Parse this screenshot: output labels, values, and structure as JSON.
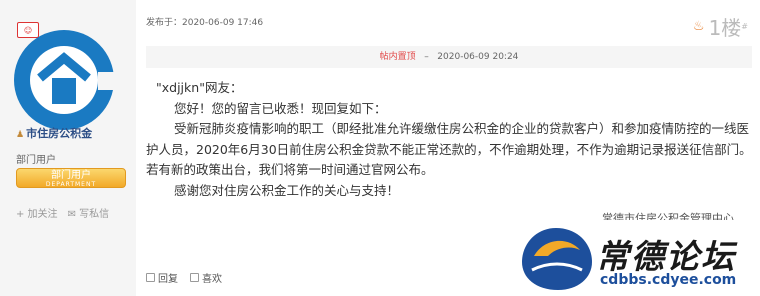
{
  "sidebar": {
    "author": "市住房公积金",
    "group": "部门用户",
    "badge": {
      "main": "部门用户",
      "sub": "DEPARTMENT"
    },
    "actions": {
      "follow": "+ 加关注",
      "message": "写私信"
    }
  },
  "post": {
    "posted_at": "发布于：2020-06-09 17:46",
    "floor": "1楼",
    "floor_mark": "#",
    "review": {
      "tag": "帖内置顶",
      "sep": "–",
      "date": "2020-06-09 20:24"
    },
    "lines": [
      "\"xdjjkn\"网友：",
      "您好！您的留言已收悉！现回复如下：",
      "受新冠肺炎疫情影响的职工（即经批准允许缓缴住房公积金的企业的贷款客户）和参加疫情防控的一线医护人员，2020年6月30日前住房公积金贷款不能正常还款的，不作逾期处理，不作为逾期记录报送征信部门。若有新的政策出台，我们将第一时间通过官网公布。",
      "感谢您对住房公积金工作的关心与支持！"
    ],
    "department": "常德市住房公积金管理中心"
  },
  "footer": {
    "reply": "回复",
    "like": "喜欢"
  },
  "watermark": {
    "title": "常德论坛",
    "url": "cdbbs.cdyee.com",
    "emblem_text": "常德论坛"
  },
  "colors": {
    "logo_blue": "#1a7ac2",
    "author": "#2d4f87",
    "badge": "#f2a928",
    "tag": "#e24a4a"
  }
}
